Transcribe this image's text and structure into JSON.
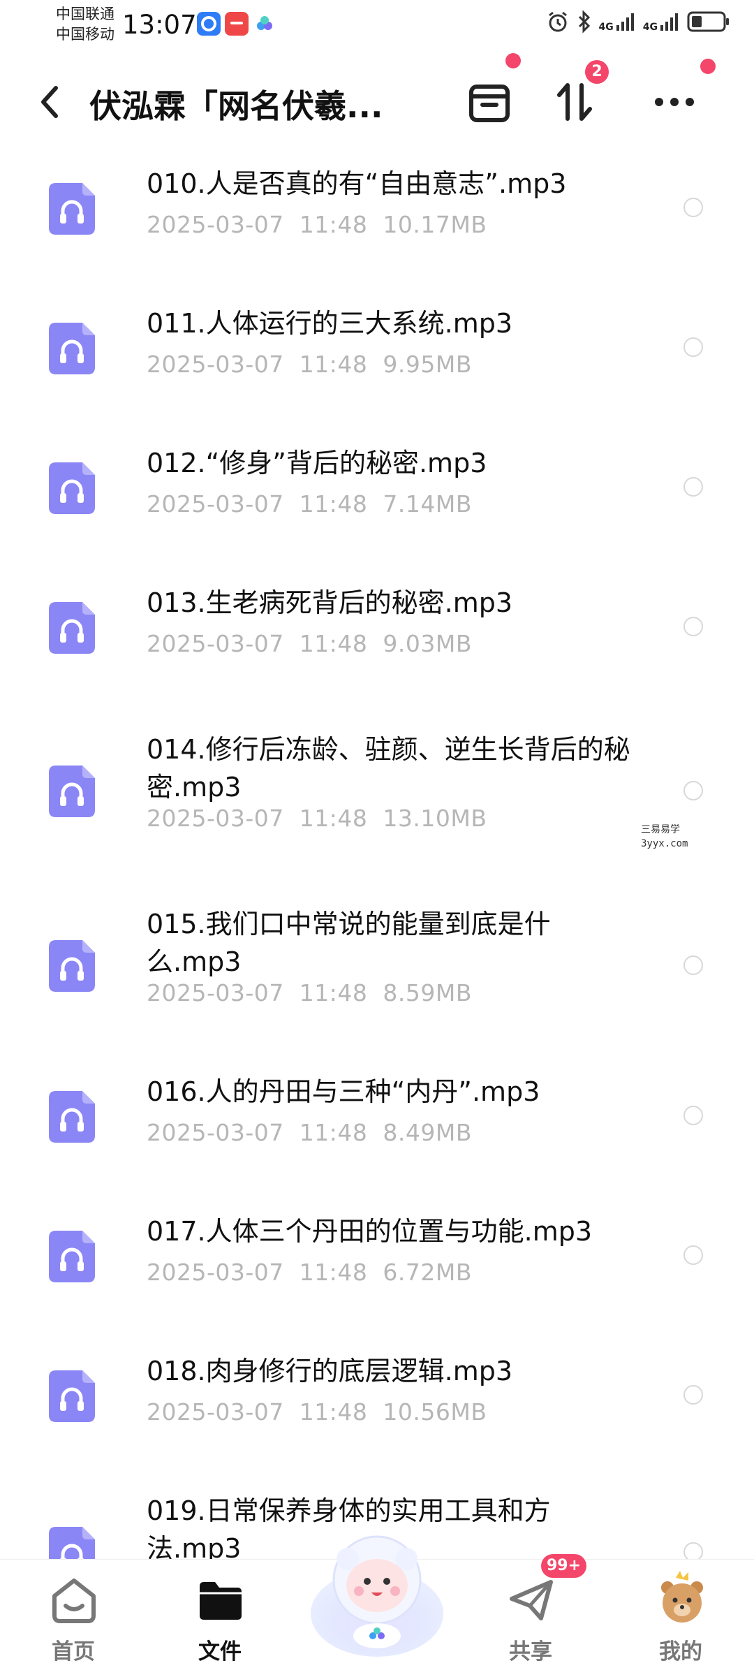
{
  "status_bar": {
    "carrier_1": "中国联通",
    "carrier_2": "中国移动",
    "time": "13:07",
    "net_1": "4G",
    "net_2": "4G",
    "app_icons": [
      "blue-app-icon",
      "red-app-icon",
      "cloud-app-icon"
    ]
  },
  "header": {
    "title": "伏泓霖「网名伏羲...",
    "sort_badge": "2"
  },
  "files": [
    {
      "name": "010.人是否真的有“自由意志”.mp3",
      "date": "2025-03-07",
      "time": "11:48",
      "size": "10.17MB"
    },
    {
      "name": "011.人体运行的三大系统.mp3",
      "date": "2025-03-07",
      "time": "11:48",
      "size": "9.95MB"
    },
    {
      "name": "012.“修身”背后的秘密.mp3",
      "date": "2025-03-07",
      "time": "11:48",
      "size": "7.14MB"
    },
    {
      "name": "013.生老病死背后的秘密.mp3",
      "date": "2025-03-07",
      "time": "11:48",
      "size": "9.03MB"
    },
    {
      "name": "014.修行后冻龄、驻颜、逆生长背后的秘密.mp3",
      "date": "2025-03-07",
      "time": "11:48",
      "size": "13.10MB"
    },
    {
      "name": "015.我们口中常说的能量到底是什么.mp3",
      "date": "2025-03-07",
      "time": "11:48",
      "size": "8.59MB"
    },
    {
      "name": "016.人的丹田与三种“内丹”.mp3",
      "date": "2025-03-07",
      "time": "11:48",
      "size": "8.49MB"
    },
    {
      "name": "017.人体三个丹田的位置与功能.mp3",
      "date": "2025-03-07",
      "time": "11:48",
      "size": "6.72MB"
    },
    {
      "name": "018.肉身修行的底层逻辑.mp3",
      "date": "2025-03-07",
      "time": "11:48",
      "size": "10.56MB"
    },
    {
      "name": "019.日常保养身体的实用工具和方法.mp3",
      "date": "",
      "time": "",
      "size": ""
    }
  ],
  "watermark": {
    "line1": "三易易学",
    "line2": "3yyx.com"
  },
  "bottom_nav": {
    "home": "首页",
    "files": "文件",
    "share": "共享",
    "share_badge": "99+",
    "mine": "我的"
  },
  "colors": {
    "accent_purple": "#8a86f5",
    "badge_red": "#f4466a",
    "meta_gray": "#b6b6b6"
  }
}
